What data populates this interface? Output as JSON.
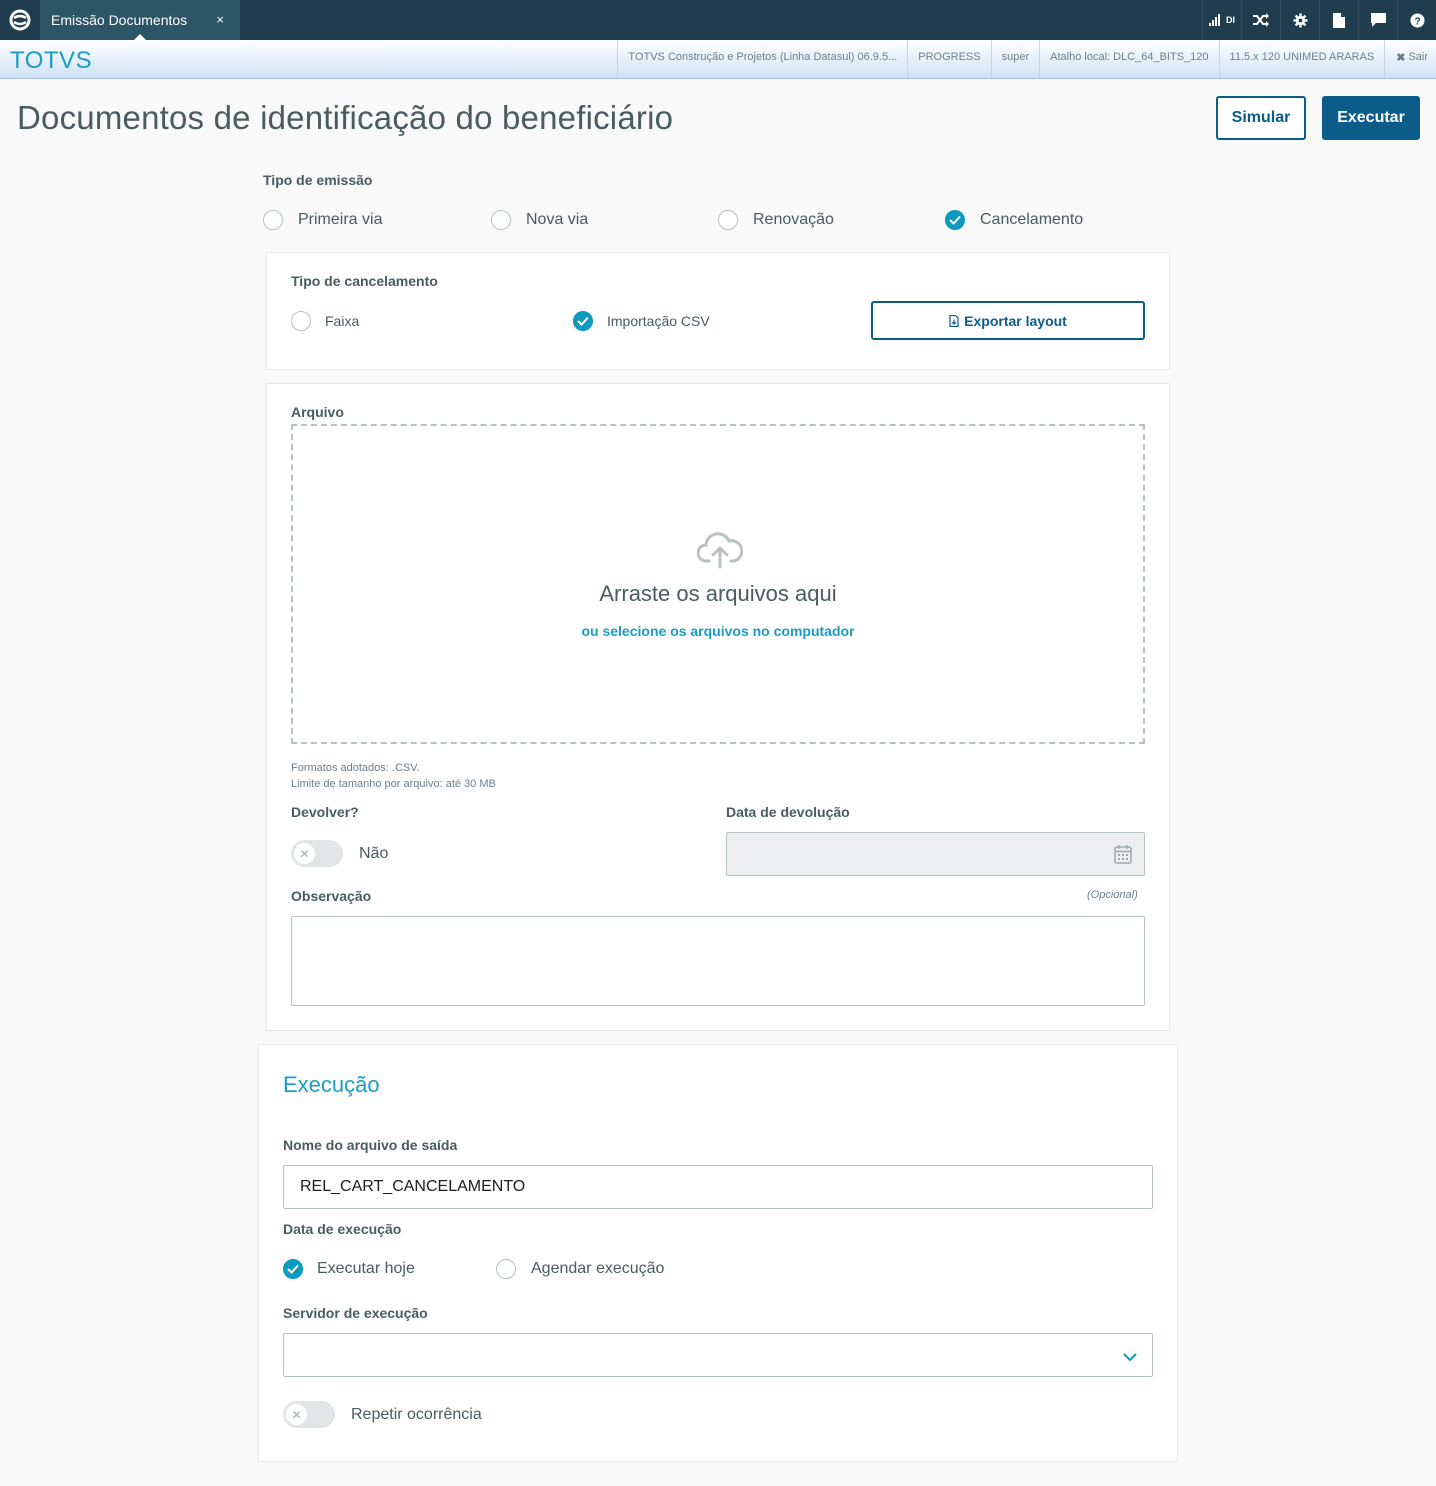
{
  "topbar": {
    "tab_label": "Emissão Documentos",
    "tab_close": "×",
    "signal_label": "DI"
  },
  "subbar": {
    "brand": "TOTVS",
    "items": [
      "TOTVS Construção e Projetos (Linha Datasul) 06.9.5...",
      "PROGRESS",
      "super",
      "Atalho local: DLC_64_BITS_120",
      "11.5.x 120 UNIMED ARARAS"
    ],
    "exit_label": "Sair"
  },
  "header": {
    "title": "Documentos de identificação do beneficiário",
    "simulate_label": "Simular",
    "execute_label": "Executar"
  },
  "emission": {
    "label": "Tipo de emissão",
    "options": [
      "Primeira via",
      "Nova via",
      "Renovação",
      "Cancelamento"
    ],
    "selected": "Cancelamento"
  },
  "cancel": {
    "label": "Tipo de cancelamento",
    "options": [
      "Faixa",
      "Importação CSV"
    ],
    "selected": "Importação CSV",
    "export_label": "Exportar layout"
  },
  "file": {
    "label": "Arquivo",
    "drop_title": "Arraste os arquivos aqui",
    "drop_link": "ou selecione os arquivos no computador",
    "formats": "Formatos adotados: .CSV.",
    "size_limit": "Limite de tamanho por arquivo: até 30 MB"
  },
  "return": {
    "label": "Devolver?",
    "toggle_text": "Não",
    "date_label": "Data de devolução"
  },
  "observation": {
    "label": "Observação",
    "optional": "(Opcional)"
  },
  "execution": {
    "title": "Execução",
    "output_label": "Nome do arquivo de saída",
    "output_value": "REL_CART_CANCELAMENTO",
    "date_label": "Data de execução",
    "date_options": [
      "Executar hoje",
      "Agendar execução"
    ],
    "date_selected": "Executar hoje",
    "server_label": "Servidor de execução",
    "repeat_label": "Repetir ocorrência"
  },
  "colors": {
    "accent": "#0c9abe",
    "primary": "#0c5c8a",
    "topbar": "#1f3d4d"
  }
}
